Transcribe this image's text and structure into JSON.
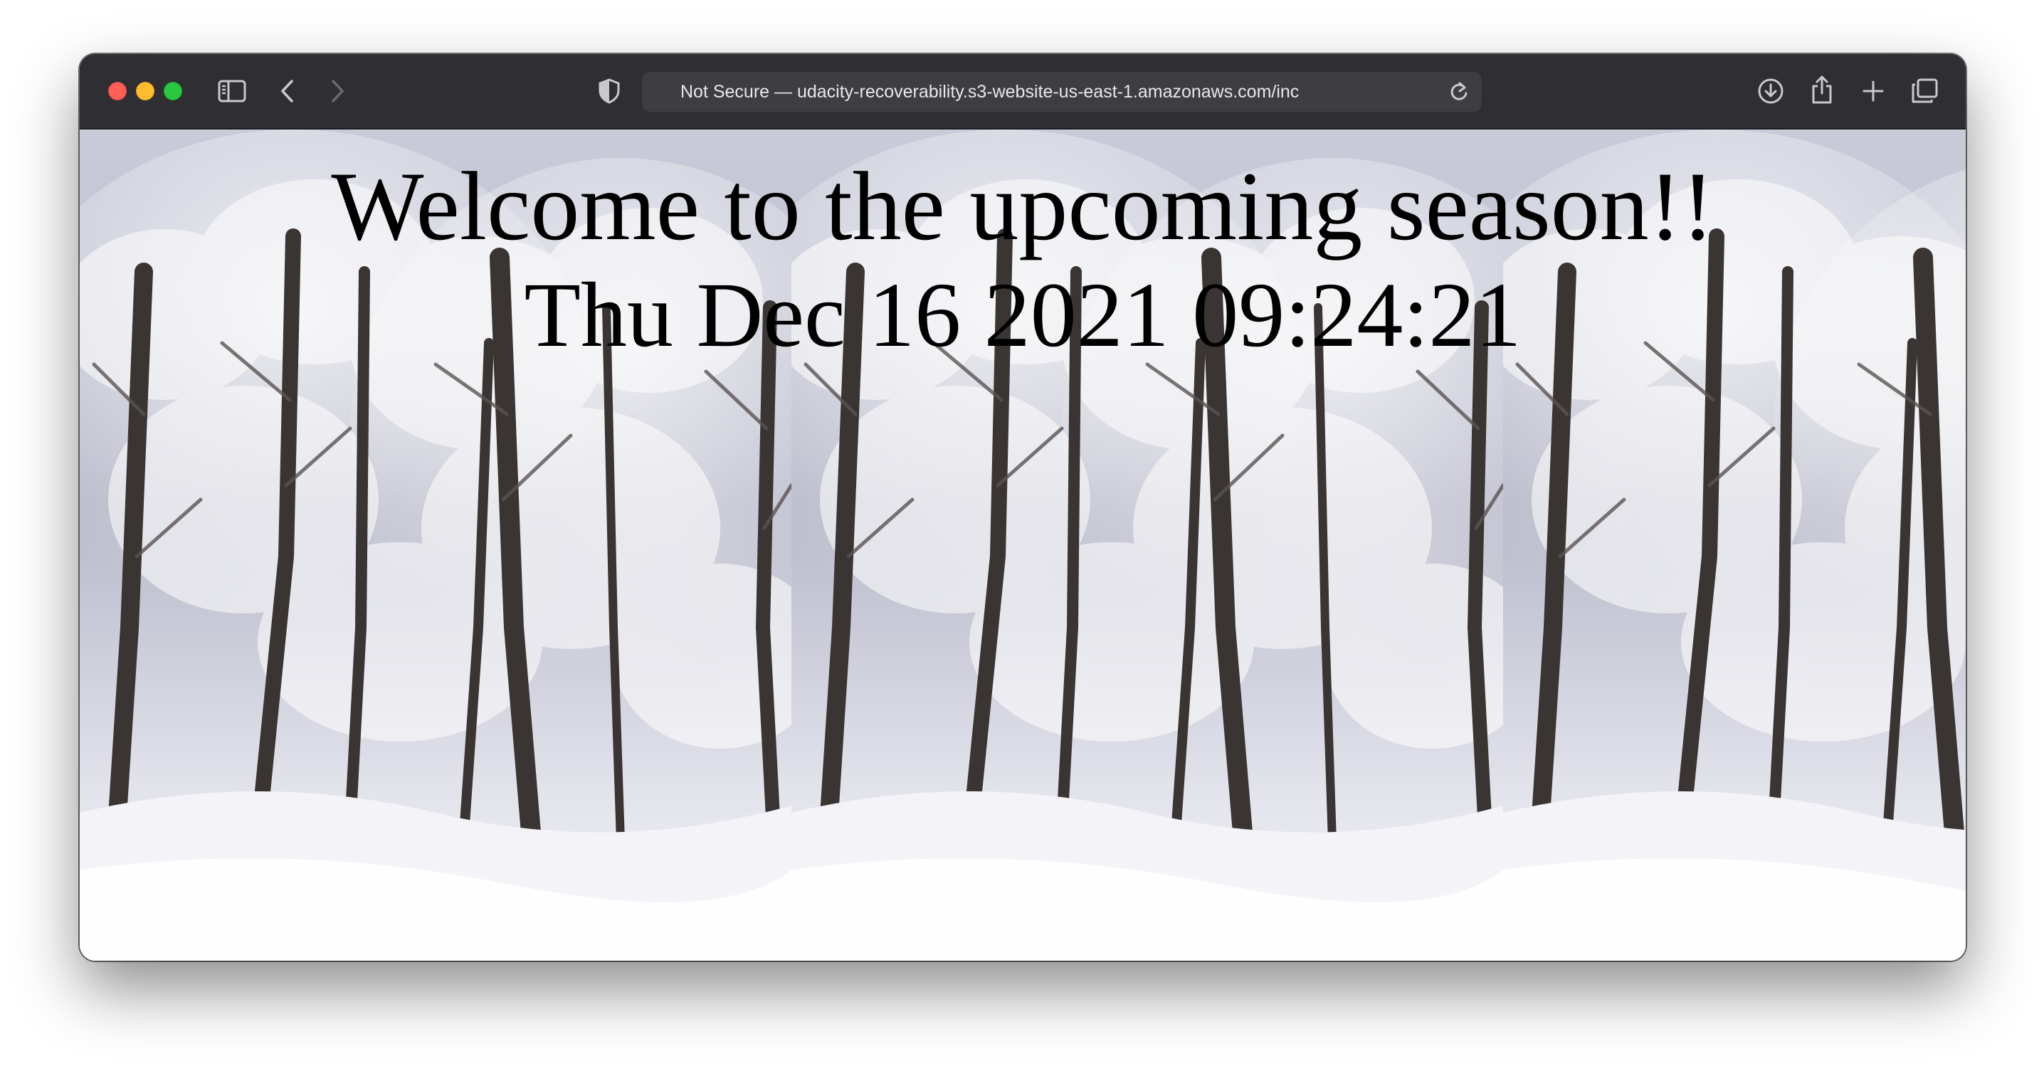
{
  "window": {
    "controls": [
      "close",
      "minimize",
      "zoom"
    ]
  },
  "toolbar": {
    "icons": {
      "sidebar": "sidebar-icon",
      "back": "chevron-left-icon",
      "forward": "chevron-right-icon",
      "privacy": "shield-icon",
      "reload": "reload-icon",
      "downloads": "download-icon",
      "share": "share-icon",
      "new_tab": "plus-icon",
      "tab_overview": "tabs-icon"
    },
    "address": {
      "text": "Not Secure — udacity-recoverability.s3-website-us-east-1.amazonaws.com/inc"
    }
  },
  "page": {
    "heading": "Welcome to the upcoming season!!",
    "datetime": "Thu Dec 16 2021 09:24:21",
    "background": "snowy-forest-image"
  },
  "colors": {
    "toolbar": "#2f2e33",
    "address_bar": "#3e3d42",
    "text": "#000000"
  }
}
